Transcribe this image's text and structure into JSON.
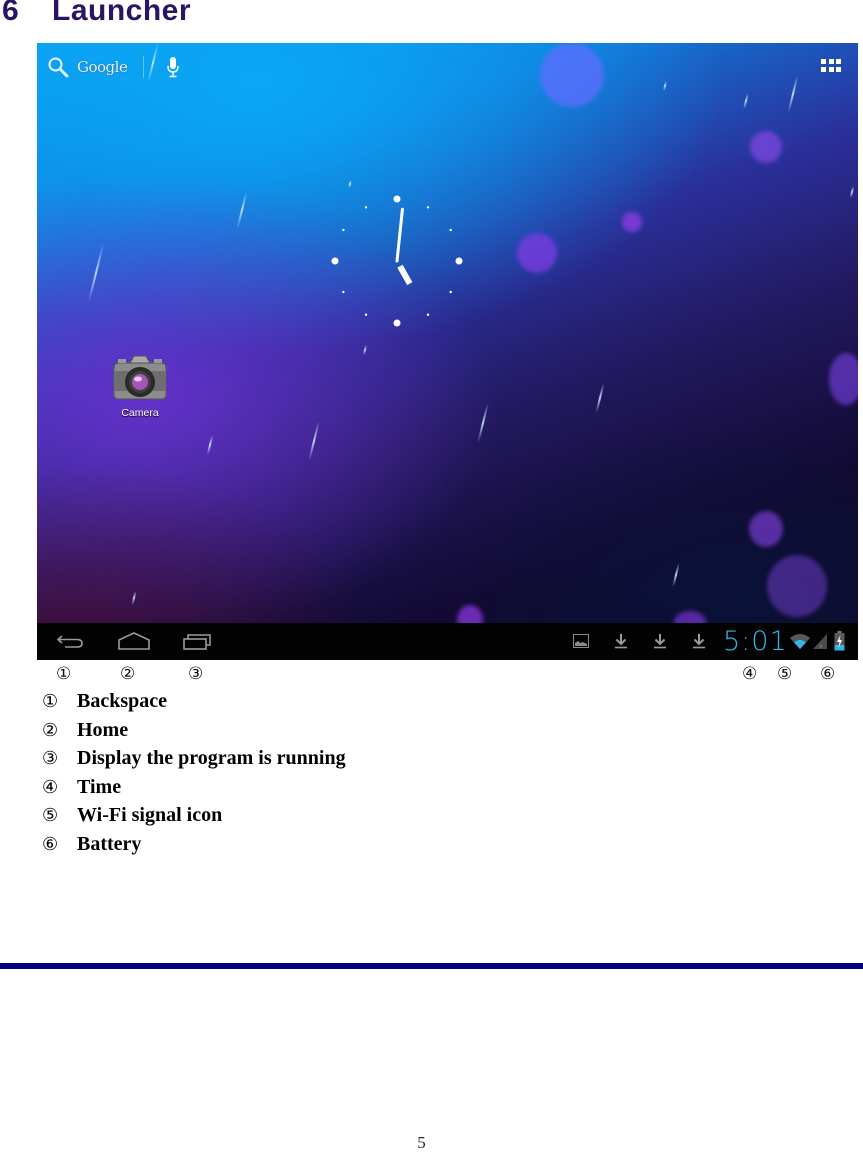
{
  "section": {
    "number": "6",
    "title": "Launcher"
  },
  "screen": {
    "search": {
      "label": "Google",
      "icons": [
        "search-icon",
        "microphone-icon"
      ]
    },
    "apps_button_icon": "apps-grid-icon",
    "clock": {
      "hour": 5,
      "minute": 1
    },
    "apps": [
      {
        "label": "Camera",
        "icon": "camera-icon"
      }
    ],
    "navbar": {
      "buttons": [
        {
          "name": "back",
          "icon": "back-arrow-icon"
        },
        {
          "name": "home",
          "icon": "home-icon"
        },
        {
          "name": "recent-apps",
          "icon": "recent-apps-icon"
        }
      ],
      "notifications": [
        "image-notification-icon",
        "download-icon",
        "download-icon",
        "download-icon"
      ],
      "time": "5:01",
      "status_icons": [
        "wifi-icon",
        "cell-signal-icon",
        "battery-charging-icon"
      ],
      "accent_color": "#33b5e5"
    }
  },
  "callouts": [
    "①",
    "②",
    "③",
    "④",
    "⑤",
    "⑥"
  ],
  "legend": [
    {
      "mark": "①",
      "text": "Backspace"
    },
    {
      "mark": "②",
      "text": "Home"
    },
    {
      "mark": "③",
      "text": "Display the program is running"
    },
    {
      "mark": "④",
      "text": "Time"
    },
    {
      "mark": "⑤",
      "text": "Wi-Fi signal icon"
    },
    {
      "mark": "⑥",
      "text": "Battery"
    }
  ],
  "footer": {
    "rule_color": "#000080",
    "page_number": "5"
  }
}
